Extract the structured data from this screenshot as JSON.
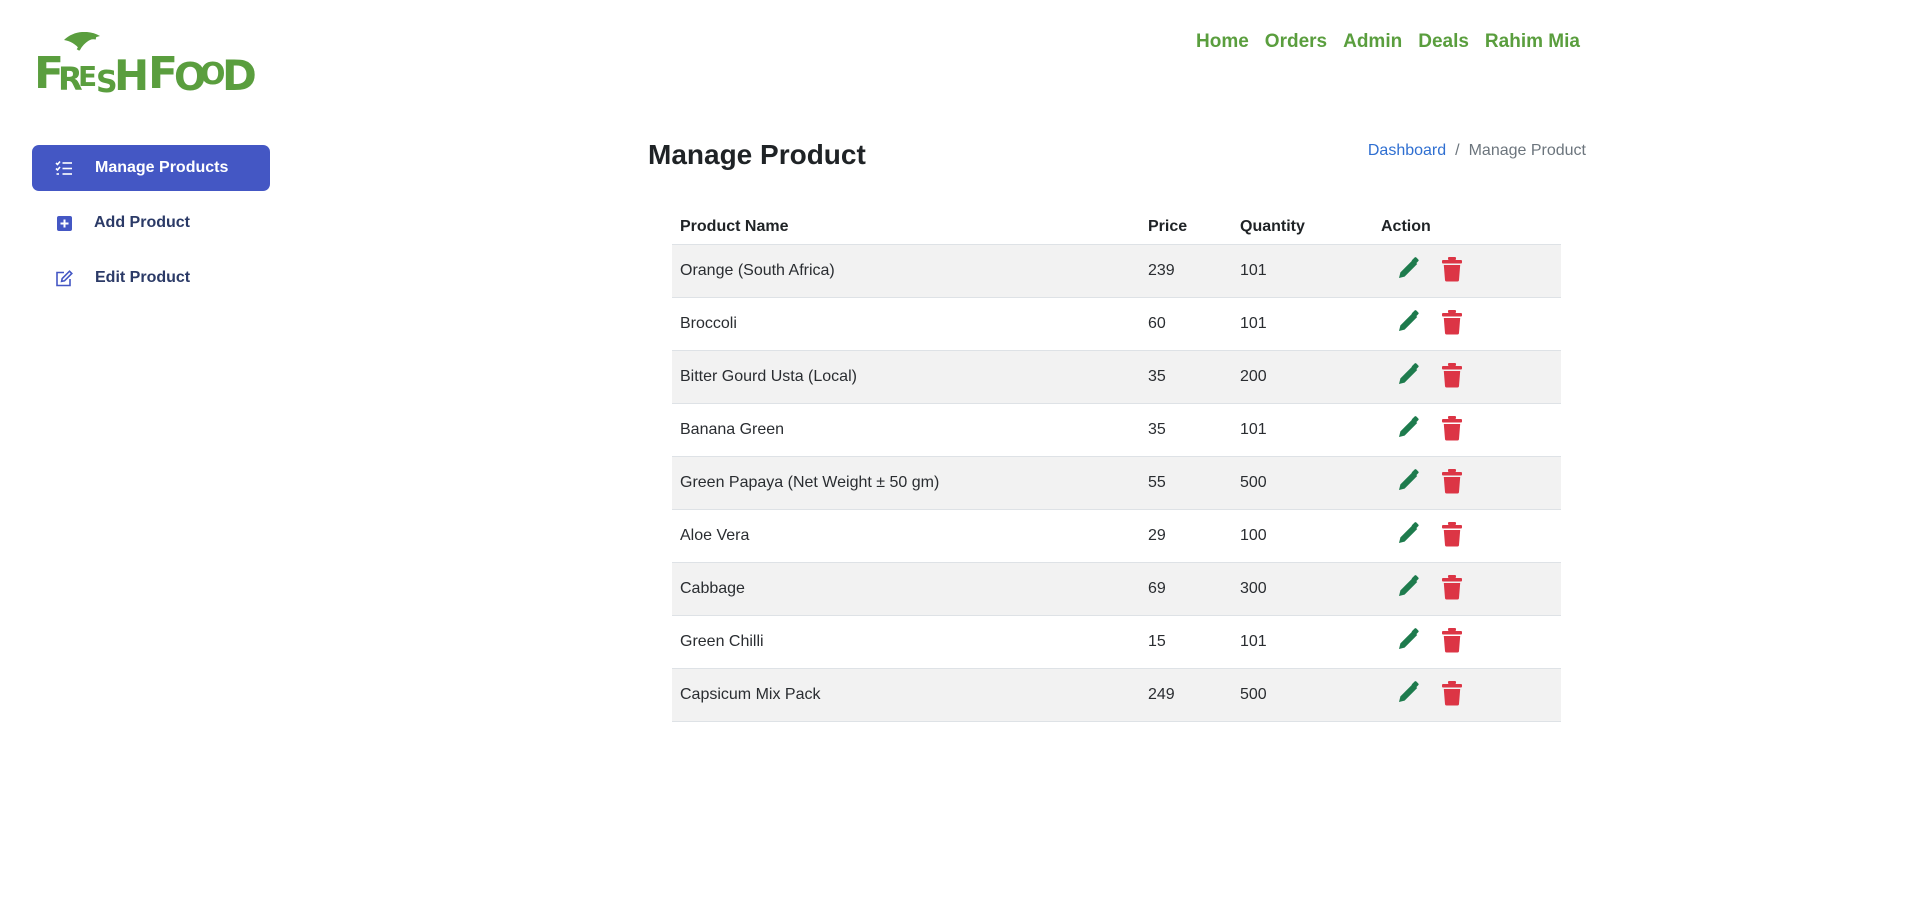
{
  "brand": {
    "logo_text": "FRESH FOOD",
    "color": "#5a9e3e"
  },
  "nav": {
    "items": [
      "Home",
      "Orders",
      "Admin",
      "Deals",
      "Rahim Mia"
    ]
  },
  "sidebar": {
    "items": [
      {
        "label": "Manage Products",
        "icon": "list-check-icon",
        "active": true
      },
      {
        "label": "Add Product",
        "icon": "plus-square-icon",
        "active": false
      },
      {
        "label": "Edit Product",
        "icon": "edit-icon",
        "active": false
      }
    ]
  },
  "page": {
    "title": "Manage Product"
  },
  "breadcrumb": {
    "link": "Dashboard",
    "separator": "/",
    "current": "Manage Product"
  },
  "table": {
    "headers": [
      "Product Name",
      "Price",
      "Quantity",
      "Action"
    ],
    "rows": [
      {
        "name": "Orange (South Africa)",
        "price": "239",
        "quantity": "101"
      },
      {
        "name": "Broccoli",
        "price": "60",
        "quantity": "101"
      },
      {
        "name": "Bitter Gourd Usta (Local)",
        "price": "35",
        "quantity": "200"
      },
      {
        "name": "Banana Green",
        "price": "35",
        "quantity": "101"
      },
      {
        "name": "Green Papaya (Net Weight ± 50 gm)",
        "price": "55",
        "quantity": "500"
      },
      {
        "name": "Aloe Vera",
        "price": "29",
        "quantity": "100"
      },
      {
        "name": "Cabbage",
        "price": "69",
        "quantity": "300"
      },
      {
        "name": "Green Chilli",
        "price": "15",
        "quantity": "101"
      },
      {
        "name": "Capsicum Mix Pack",
        "price": "249",
        "quantity": "500"
      }
    ]
  },
  "colors": {
    "edit_icon": "#1e7b4d",
    "delete_icon": "#dc3545",
    "active_nav": "#4457c4",
    "link": "#2f6fd1"
  }
}
